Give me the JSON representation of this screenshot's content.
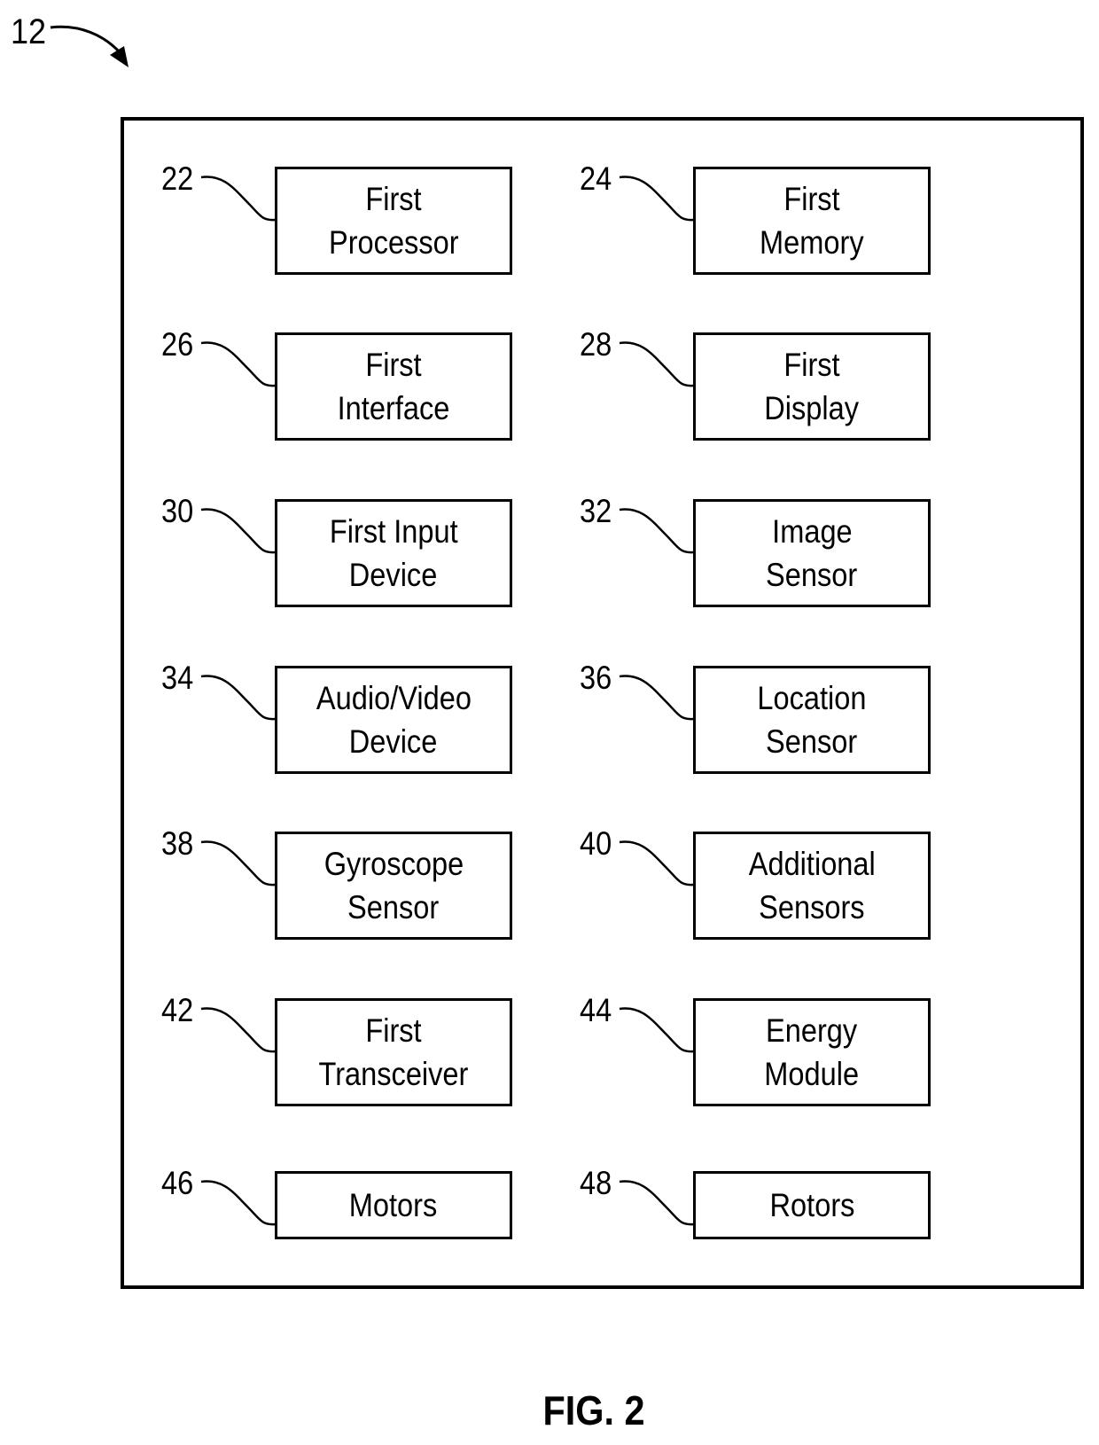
{
  "figure": {
    "reference_number": "12",
    "caption": "FIG. 2"
  },
  "components": [
    {
      "ref": "22",
      "lines": [
        "First",
        "Processor"
      ]
    },
    {
      "ref": "24",
      "lines": [
        "First",
        "Memory"
      ]
    },
    {
      "ref": "26",
      "lines": [
        "First",
        "Interface"
      ]
    },
    {
      "ref": "28",
      "lines": [
        "First",
        "Display"
      ]
    },
    {
      "ref": "30",
      "lines": [
        "First Input",
        "Device"
      ]
    },
    {
      "ref": "32",
      "lines": [
        "Image",
        "Sensor"
      ]
    },
    {
      "ref": "34",
      "lines": [
        "Audio/Video",
        "Device"
      ]
    },
    {
      "ref": "36",
      "lines": [
        "Location",
        "Sensor"
      ]
    },
    {
      "ref": "38",
      "lines": [
        "Gyroscope",
        "Sensor"
      ]
    },
    {
      "ref": "40",
      "lines": [
        "Additional",
        "Sensors"
      ]
    },
    {
      "ref": "42",
      "lines": [
        "First",
        "Transceiver"
      ]
    },
    {
      "ref": "44",
      "lines": [
        "Energy",
        "Module"
      ]
    },
    {
      "ref": "46",
      "lines": [
        "Motors"
      ]
    },
    {
      "ref": "48",
      "lines": [
        "Rotors"
      ]
    }
  ]
}
